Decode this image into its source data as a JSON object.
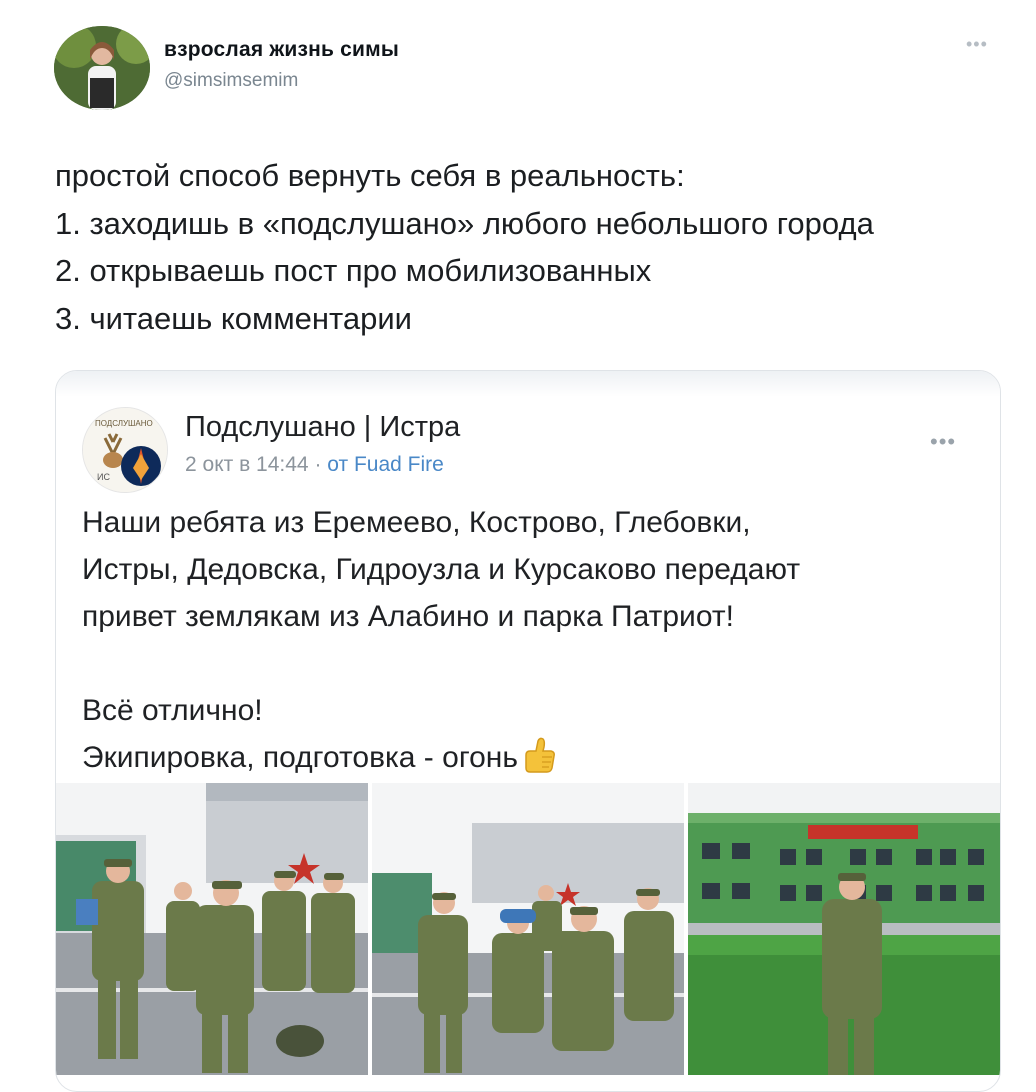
{
  "tweet": {
    "author_name": "взрослая жизнь симы",
    "author_handle": "@simsimsemim",
    "more_icon": "more-horizontal-icon",
    "text_lines": [
      "простой способ вернуть себя в реальность:",
      "1. заходишь в «подслушано» любого небольшого города",
      "2. открываешь пост про мобилизованных",
      "3. читаешь комментарии"
    ]
  },
  "embed": {
    "group_name": "Подслушано | Истра",
    "date": "2 окт в 14:44",
    "separator": " · ",
    "from_label": "от Fuad Fire",
    "more_icon": "more-horizontal-icon",
    "post_lines": [
      "Наши ребята из Еремеево, Кострово, Глебовки,",
      "Истры, Дедовска, Гидроузла и Курсаково передают",
      "привет землякам из Алабино и парка Патриот!",
      "",
      "Всё отлично!",
      "Экипировка, подготовка - огонь"
    ],
    "emoji": "thumbs-up-icon",
    "photos": [
      "group-photo-1",
      "group-photo-2",
      "building-photo"
    ]
  },
  "colors": {
    "handle": "#7a8690",
    "link": "#4a88c7",
    "border": "#dfe3e7",
    "uniform": "#6b7a4a",
    "building_green": "#4e9a52"
  }
}
